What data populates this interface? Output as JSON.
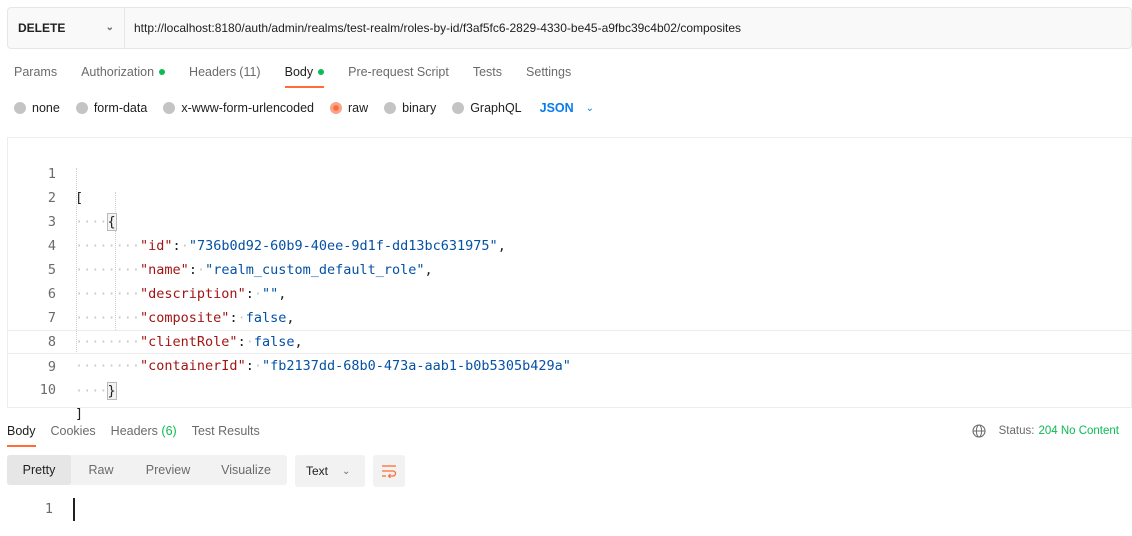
{
  "request": {
    "method": "DELETE",
    "url": "http://localhost:8180/auth/admin/realms/test-realm/roles-by-id/f3af5fc6-2829-4330-be45-a9fbc39c4b02/composites"
  },
  "request_tabs": [
    {
      "label": "Params"
    },
    {
      "label": "Authorization",
      "dot": true
    },
    {
      "label": "Headers",
      "count": "(11)"
    },
    {
      "label": "Body",
      "dot": true,
      "active": true
    },
    {
      "label": "Pre-request Script"
    },
    {
      "label": "Tests"
    },
    {
      "label": "Settings"
    }
  ],
  "body_types": [
    "none",
    "form-data",
    "x-www-form-urlencoded",
    "raw",
    "binary",
    "GraphQL"
  ],
  "body_type_selected": "raw",
  "body_language": "JSON",
  "editor_lines": [
    "1",
    "2",
    "3",
    "4",
    "5",
    "6",
    "7",
    "8",
    "9",
    "10"
  ],
  "body_json": {
    "open_array": "[",
    "open_obj": "{",
    "close_obj": "}",
    "close_array": "]",
    "fields": [
      {
        "key": "\"id\"",
        "value": "\"736b0d92-60b9-40ee-9d1f-dd13bc631975\"",
        "kind": "str",
        "comma": ","
      },
      {
        "key": "\"name\"",
        "value": "\"realm_custom_default_role\"",
        "kind": "str",
        "comma": ","
      },
      {
        "key": "\"description\"",
        "value": "\"\"",
        "kind": "str",
        "comma": ","
      },
      {
        "key": "\"composite\"",
        "value": "false",
        "kind": "kw",
        "comma": ","
      },
      {
        "key": "\"clientRole\"",
        "value": "false",
        "kind": "kw",
        "comma": ","
      },
      {
        "key": "\"containerId\"",
        "value": "\"fb2137dd-68b0-473a-aab1-b0b5305b429a\"",
        "kind": "str",
        "comma": ""
      }
    ]
  },
  "response_tabs": [
    {
      "label": "Body",
      "active": true
    },
    {
      "label": "Cookies"
    },
    {
      "label": "Headers",
      "count": "(6)"
    },
    {
      "label": "Test Results"
    }
  ],
  "response_status": {
    "label": "Status:",
    "code": "204 No Content"
  },
  "response_views": [
    "Pretty",
    "Raw",
    "Preview",
    "Visualize"
  ],
  "response_format": "Text",
  "response_line": "1",
  "colors": {
    "accent": "#ff6c37",
    "success": "#0cbb52",
    "link": "#097bed",
    "key": "#a31515",
    "value": "#0451a5"
  },
  "icons": {
    "method_dropdown": "chevron-down-icon",
    "status": "globe-icon",
    "wrap": "wrap-lines-icon"
  }
}
